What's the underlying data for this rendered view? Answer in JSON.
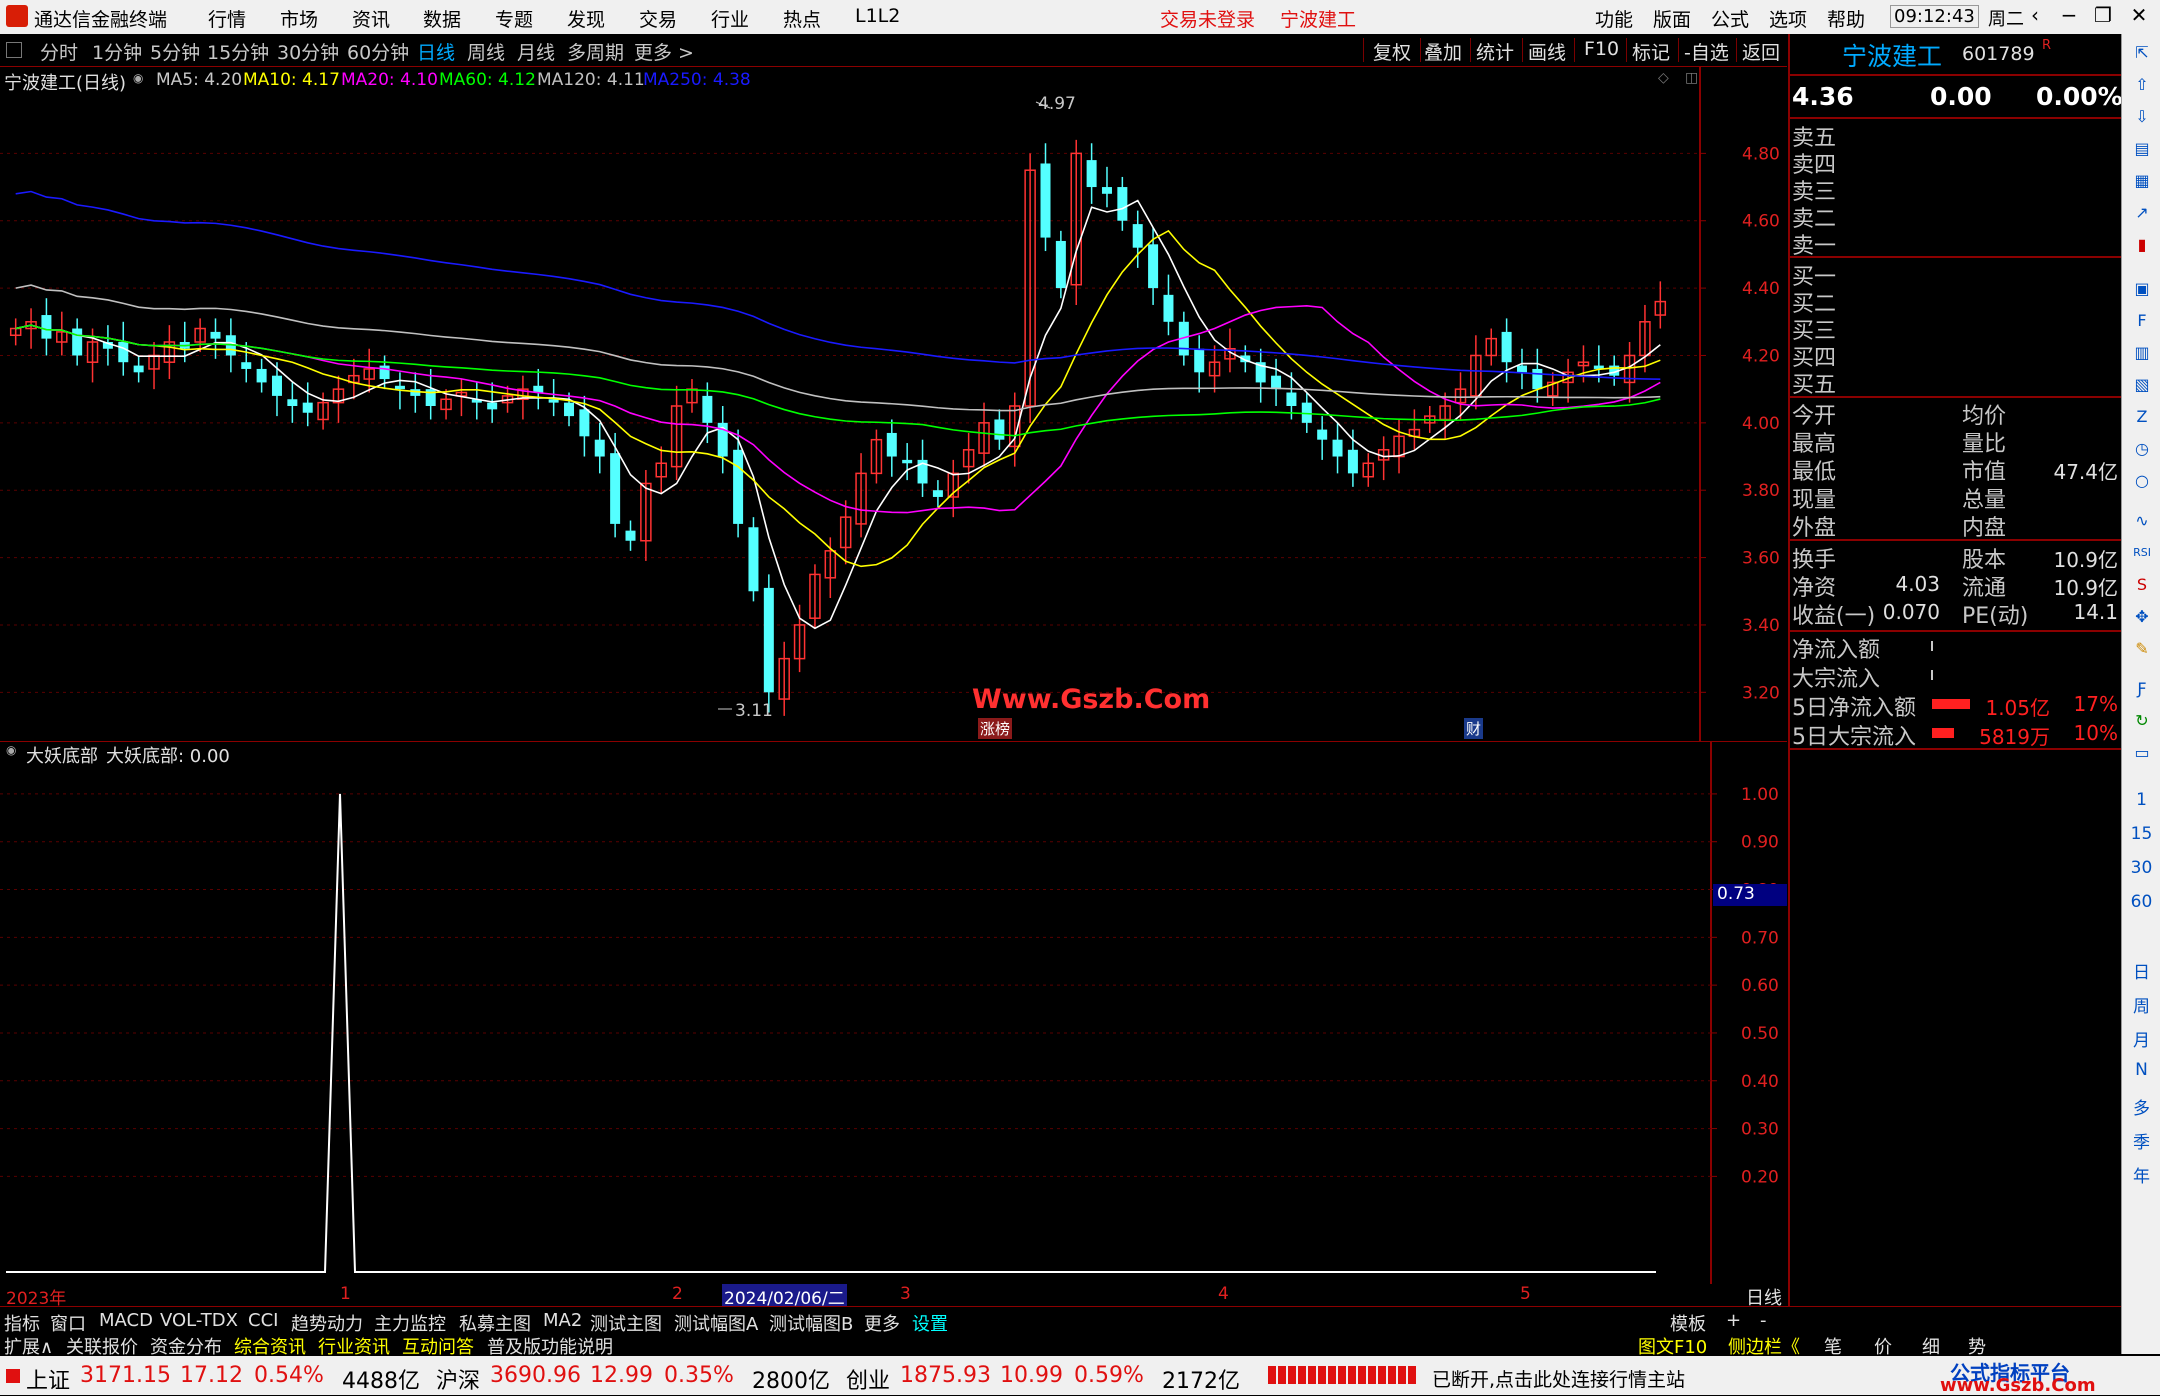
{
  "app": {
    "title": "通达信金融终端",
    "menu": [
      "行情",
      "市场",
      "资讯",
      "数据",
      "专题",
      "发现",
      "交易",
      "行业",
      "热点",
      "L1L2"
    ],
    "login_status": "交易未登录",
    "stock_title": "宁波建工",
    "right_menu": [
      "功能",
      "版面",
      "公式",
      "选项",
      "帮助"
    ],
    "time": "09:12:43",
    "weekday": "周二"
  },
  "period_bar": {
    "periods": [
      "分时",
      "1分钟",
      "5分钟",
      "15分钟",
      "30分钟",
      "60分钟",
      "日线",
      "周线",
      "月线",
      "多周期",
      "更多 >"
    ],
    "active": "日线",
    "tools": [
      "复权",
      "叠加",
      "统计",
      "画线",
      "F10",
      "标记",
      "-自选",
      "返回"
    ]
  },
  "main_chart": {
    "label": "宁波建工(日线)",
    "ma_labels": [
      {
        "text": "MA5: 4.20",
        "color": "#ffffff"
      },
      {
        "text": "MA10: 4.17",
        "color": "#ffff00"
      },
      {
        "text": "MA20: 4.10",
        "color": "#ff00ff"
      },
      {
        "text": "MA60: 4.12",
        "color": "#00ff00"
      },
      {
        "text": "MA120: 4.11",
        "color": "#c0c0c0"
      },
      {
        "text": "MA250: 4.38",
        "color": "#1a1aff"
      }
    ],
    "high_label": "4.97",
    "low_label": "3.11",
    "watermark": "Www.Gszb.Com",
    "tag_zhangbang": "涨榜",
    "tag_cai": "财"
  },
  "chart_data": [
    {
      "type": "candlestick",
      "title": "宁波建工(日线)",
      "ylim": [
        3.1,
        5.0
      ],
      "y_ticks": [
        "4.80",
        "4.60",
        "4.40",
        "4.20",
        "4.00",
        "3.80",
        "3.60",
        "3.40",
        "3.20"
      ],
      "x_labels": [
        "2023年",
        "1",
        "2",
        "2024/02/06/二",
        "3",
        "4",
        "5"
      ],
      "series_close": [
        4.28,
        4.3,
        4.25,
        4.27,
        4.2,
        4.24,
        4.22,
        4.18,
        4.15,
        4.2,
        4.24,
        4.22,
        4.28,
        4.25,
        4.2,
        4.16,
        4.12,
        4.08,
        4.05,
        4.03,
        4.06,
        4.1,
        4.14,
        4.16,
        4.13,
        4.1,
        4.08,
        4.05,
        4.07,
        4.09,
        4.06,
        4.04,
        4.08,
        4.1,
        4.09,
        4.06,
        4.02,
        3.96,
        3.9,
        3.7,
        3.65,
        3.82,
        3.88,
        4.05,
        4.1,
        4.0,
        3.9,
        3.7,
        3.5,
        3.2,
        3.3,
        3.4,
        3.55,
        3.62,
        3.72,
        3.85,
        3.95,
        3.9,
        3.88,
        3.82,
        3.78,
        3.85,
        3.92,
        4.0,
        3.95,
        4.05,
        4.75,
        4.55,
        4.4,
        4.8,
        4.7,
        4.68,
        4.6,
        4.52,
        4.4,
        4.3,
        4.2,
        4.15,
        4.18,
        4.22,
        4.18,
        4.12,
        4.1,
        4.05,
        4.0,
        3.95,
        3.9,
        3.85,
        3.88,
        3.92,
        3.96,
        3.98,
        4.02,
        4.05,
        4.1,
        4.2,
        4.25,
        4.18,
        4.15,
        4.1,
        4.12,
        4.15,
        4.18,
        4.16,
        4.14,
        4.2,
        4.3,
        4.36
      ],
      "ma_series": [
        {
          "name": "MA5",
          "color": "#ffffff"
        },
        {
          "name": "MA10",
          "color": "#ffff00"
        },
        {
          "name": "MA20",
          "color": "#ff00ff"
        },
        {
          "name": "MA60",
          "color": "#00ff00"
        },
        {
          "name": "MA120",
          "color": "#c0c0c0"
        },
        {
          "name": "MA250",
          "color": "#1a1aff"
        }
      ]
    },
    {
      "type": "line",
      "title": "大妖底部",
      "ylim": [
        0,
        1.05
      ],
      "y_ticks": [
        "1.00",
        "0.90",
        "0.80",
        "0.70",
        "0.60",
        "0.50",
        "0.40",
        "0.30",
        "0.20"
      ],
      "current_value": "0.73",
      "series": [
        {
          "name": "大妖底部",
          "values_nonzero_index": 22,
          "peak": 1.0
        }
      ]
    }
  ],
  "sub_chart": {
    "label": "大妖底部",
    "value_label": "大妖底部: 0.00",
    "current_tag": "0.73"
  },
  "right_panel": {
    "name": "宁波建工",
    "code": "601789",
    "code_mark": "R",
    "price": "4.36",
    "change": "0.00",
    "change_pct": "0.00%",
    "sell": [
      "卖五",
      "卖四",
      "卖三",
      "卖二",
      "卖一"
    ],
    "buy": [
      "买一",
      "买二",
      "买三",
      "买四",
      "买五"
    ],
    "stats_left": [
      "今开",
      "最高",
      "最低",
      "现量",
      "外盘"
    ],
    "stats_right": [
      "均价",
      "量比",
      "市值",
      "总量",
      "内盘"
    ],
    "market_value": "47.4亿",
    "fund_rows": [
      {
        "l": "换手",
        "lv": "",
        "r": "股本",
        "rv": "10.9亿"
      },
      {
        "l": "净资",
        "lv": "4.03",
        "r": "流通",
        "rv": "10.9亿"
      },
      {
        "l": "收益(一)",
        "lv": "0.070",
        "r": "PE(动)",
        "rv": "14.1"
      }
    ],
    "flow_rows": [
      {
        "l": "净流入额",
        "v": "",
        "p": ""
      },
      {
        "l": "大宗流入",
        "v": "",
        "p": ""
      },
      {
        "l": "5日净流入额",
        "v": "1.05亿",
        "p": "17%"
      },
      {
        "l": "5日大宗流入",
        "v": "5819万",
        "p": "10%"
      }
    ]
  },
  "icon_strip_labels": [
    "1",
    "15",
    "30",
    "60",
    "日",
    "周",
    "月",
    "N",
    "多",
    "季",
    "年"
  ],
  "bottom_tabs_1": [
    "指标",
    "窗口",
    "MACD",
    "VOL-TDX",
    "CCI",
    "趋势动力",
    "主力监控",
    "私募主图",
    "MA2",
    "测试主图",
    "测试幅图A",
    "测试幅图B",
    "更多",
    "设置"
  ],
  "bottom_tabs_1_right": [
    "模板",
    "+",
    "-"
  ],
  "xaxis_right": "日线",
  "bottom_tabs_2": [
    "扩展∧",
    "关联报价",
    "资金分布",
    "综合资讯",
    "行业资讯",
    "互动问答",
    "普及版功能说明"
  ],
  "bottom_tabs_2_right": [
    "图文F10",
    "侧边栏《",
    "笔",
    "价",
    "细",
    "势"
  ],
  "status": {
    "sh_label": "上证",
    "sh_val": "3171.15",
    "sh_chg": "17.12",
    "sh_pct": "0.54%",
    "sh_amt": "4488亿",
    "hs_label": "沪深",
    "hs_val": "3690.96",
    "hs_chg": "12.99",
    "hs_pct": "0.35%",
    "hs_amt": "2800亿",
    "cy_label": "创业",
    "cy_val": "1875.93",
    "cy_chg": "10.99",
    "cy_pct": "0.59%",
    "cy_amt": "2172亿",
    "msg": "已断开,点击此处连接行情主站",
    "brand_top": "公式指标平台",
    "brand_bot": "www.Gszb.Com"
  }
}
